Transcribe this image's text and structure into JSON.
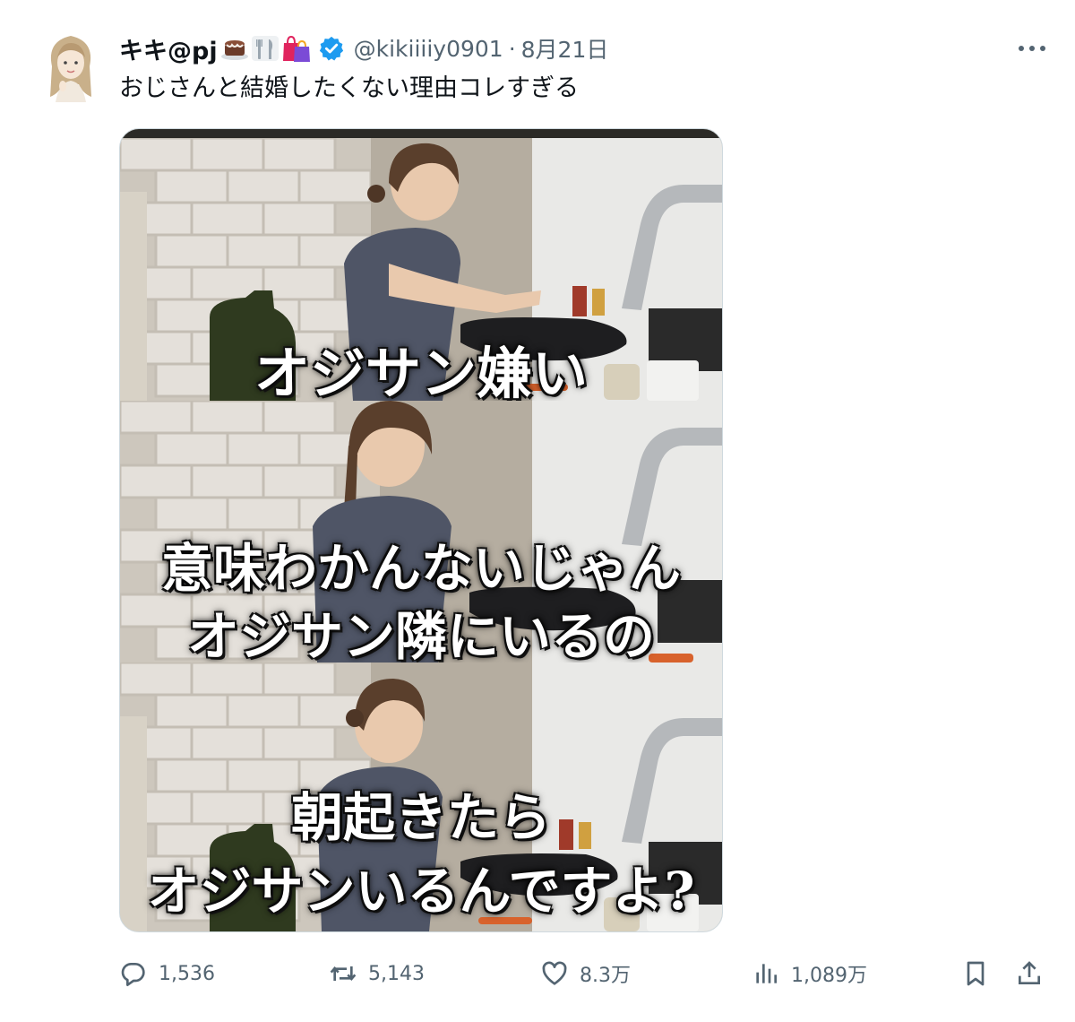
{
  "author": {
    "display_name": "キキ@pj",
    "name_emojis": [
      "cake-icon",
      "fork-knife-icon",
      "shopping-bags-icon"
    ],
    "handle": "@kikiiiiy0901",
    "separator": "·",
    "date": "8月21日",
    "verified": true,
    "verified_color": "#1d9bf0"
  },
  "tweet": {
    "text": "おじさんと結婚したくない理由コレすぎる"
  },
  "media": {
    "panels": [
      {
        "captions": [
          "オジサン嫌い"
        ]
      },
      {
        "captions": [
          "意味わかんないじゃん",
          "オジサン隣にいるの"
        ]
      },
      {
        "captions": [
          "朝起きたら",
          "オジサンいるんですよ?"
        ]
      }
    ]
  },
  "actions": {
    "replies": "1,536",
    "retweets": "5,143",
    "likes": "8.3万",
    "views": "1,089万"
  },
  "colors": {
    "text_primary": "#0f1419",
    "text_secondary": "#536471",
    "border": "#cfd9de"
  }
}
